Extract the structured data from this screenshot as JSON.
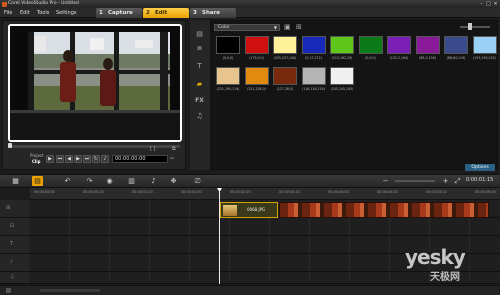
{
  "window": {
    "title": "Corel VideoStudio Pro - Untitled"
  },
  "menu": [
    "File",
    "Edit",
    "Tools",
    "Settings"
  ],
  "tabs": [
    {
      "num": "1",
      "label": "Capture"
    },
    {
      "num": "2",
      "label": "Edit"
    },
    {
      "num": "3",
      "label": "Share"
    }
  ],
  "preview": {
    "project_label": "Project",
    "clip_label": "Clip",
    "timecode": "00:00:00:00"
  },
  "library": {
    "category": "Color",
    "swatches": [
      {
        "color": "#000000",
        "label": "(0,0,0)"
      },
      {
        "color": "#ce1010",
        "label": "(175,0,0)"
      },
      {
        "color": "#fff09a",
        "label": "(255,237,140)"
      },
      {
        "color": "#1629b8",
        "label": "(0,17,172)"
      },
      {
        "color": "#5fc61a",
        "label": "(113,162,29)"
      },
      {
        "color": "#0c7a19",
        "label": "(0,0,0)"
      },
      {
        "color": "#7a1fb5",
        "label": "(132,2,164)"
      },
      {
        "color": "#8a1a9a",
        "label": "(85,0,136)"
      },
      {
        "color": "#3a4a8a",
        "label": "(86,84,119)"
      },
      {
        "color": "#9ad0f5",
        "label": "(153,193,255)"
      },
      {
        "color": "#e8c58e",
        "label": "(221,195,119)"
      },
      {
        "color": "#e2890f",
        "label": "(221,128,0)"
      },
      {
        "color": "#7a2a0c",
        "label": "(127,38,0)"
      },
      {
        "color": "#b4b4b4",
        "label": "(116,116,116)"
      },
      {
        "color": "#f0f0f0",
        "label": "(245,245,245)"
      }
    ],
    "options_label": "Options"
  },
  "timeline": {
    "timecode": "0:00:01:15",
    "ticks": [
      "00:00:00:00",
      "00:00:00:10",
      "00:00:00:20",
      "00:00:01:00",
      "00:00:01:10",
      "00:00:01:20",
      "00:00:02:00",
      "00:00:02:10",
      "00:00:02:20",
      "00:00:03:00",
      "00:00:03:10",
      "00:00:03:20",
      "00:00:04:00",
      "00:00:04:10",
      "00:00:04:20",
      "00:00:05:00",
      "00:00:05:10",
      "00:00:05:20",
      "00:00:06:00"
    ],
    "clip_name": "0068.JPG"
  },
  "watermark": {
    "text": "yesky",
    "sub": "天极网"
  }
}
